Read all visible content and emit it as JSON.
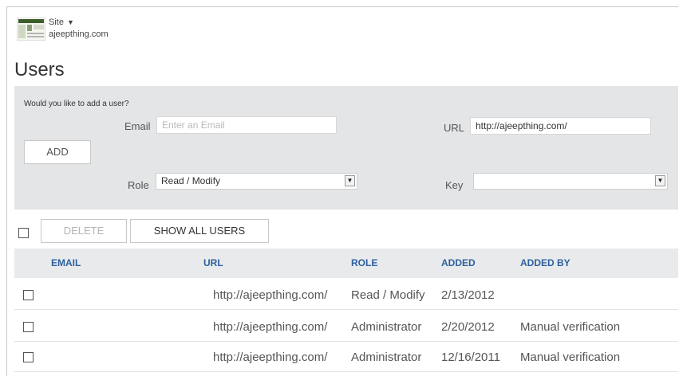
{
  "header": {
    "site_label": "Site",
    "site_domain": "ajeepthing.com",
    "page_title": "Users"
  },
  "add_user": {
    "prompt": "Would you like to add a user?",
    "email_label": "Email",
    "email_placeholder": "Enter an Email",
    "url_label": "URL",
    "url_value": "http://ajeepthing.com/",
    "add_button": "ADD",
    "role_label": "Role",
    "role_selected": "Read / Modify",
    "key_label": "Key",
    "key_selected": ""
  },
  "toolbar": {
    "delete_label": "DELETE",
    "show_all_label": "SHOW ALL USERS"
  },
  "table": {
    "headers": [
      "EMAIL",
      "URL",
      "ROLE",
      "ADDED",
      "ADDED BY"
    ],
    "rows": [
      {
        "email": "",
        "url": "http://ajeepthing.com/",
        "role": "Read / Modify",
        "added": "2/13/2012",
        "added_by": ""
      },
      {
        "email": "",
        "url": "http://ajeepthing.com/",
        "role": "Administrator",
        "added": "2/20/2012",
        "added_by": "Manual verification"
      },
      {
        "email": "",
        "url": "http://ajeepthing.com/",
        "role": "Administrator",
        "added": "12/16/2011",
        "added_by": "Manual verification"
      }
    ]
  },
  "colors": {
    "panel_bg": "#e3e5e7",
    "header_text": "#2e5f9e",
    "table_head_bg": "#e8eaec"
  },
  "icons": [
    "site-thumbnail-icon",
    "dropdown-caret-icon",
    "select-arrow-icon",
    "checkbox-icon"
  ]
}
